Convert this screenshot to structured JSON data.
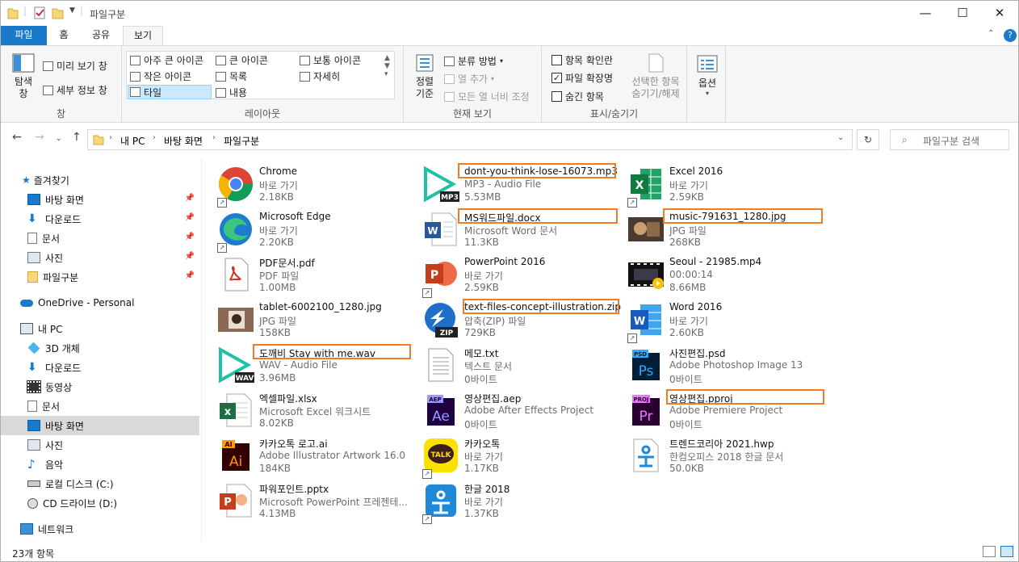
{
  "window": {
    "title": "파일구분",
    "min": "—",
    "max": "☐",
    "close": "✕"
  },
  "tabs": {
    "file": "파일",
    "home": "홈",
    "share": "공유",
    "view": "보기"
  },
  "ribbon": {
    "pane": {
      "nav_pane": "탐색\n창",
      "preview": "미리 보기 창",
      "details": "세부 정보 창",
      "label": "창"
    },
    "layout": {
      "xl": "아주 큰 아이콘",
      "large": "큰 아이콘",
      "medium": "보통 아이콘",
      "small": "작은 아이콘",
      "list": "목록",
      "details": "자세히",
      "tiles": "타일",
      "content": "내용",
      "label": "레이아웃"
    },
    "current": {
      "sort": "정렬\n기준",
      "group": "분류 방법",
      "addcol": "열 추가",
      "fit": "모든 열 너비 조정",
      "label": "현재 보기"
    },
    "show": {
      "checkboxes": "항목 확인란",
      "extensions": "파일 확장명",
      "hidden": "숨긴 항목",
      "hide_sel": "선택한 항목\n숨기기/해제",
      "label": "표시/숨기기"
    },
    "options": {
      "label": "옵션"
    }
  },
  "address": {
    "crumbs": [
      "내 PC",
      "바탕 화면",
      "파일구분"
    ],
    "search_placeholder": "파일구분 검색"
  },
  "nav": {
    "quick": "즐겨찾기",
    "quick_items": [
      "바탕 화면",
      "다운로드",
      "문서",
      "사진",
      "파일구분"
    ],
    "onedrive": "OneDrive - Personal",
    "pc": "내 PC",
    "pc_items": [
      "3D 개체",
      "다운로드",
      "동영상",
      "문서",
      "바탕 화면",
      "사진",
      "음악",
      "로컬 디스크 (C:)",
      "CD 드라이브 (D:)"
    ],
    "network": "네트워크"
  },
  "files": [
    {
      "name": "Chrome",
      "type": "바로 가기",
      "size": "2.18KB",
      "icon": "chrome-icon"
    },
    {
      "name": "Microsoft Edge",
      "type": "바로 가기",
      "size": "2.20KB",
      "icon": "edge-icon"
    },
    {
      "name": "PDF문서.pdf",
      "type": "PDF 파일",
      "size": "1.00MB",
      "icon": "pdf-icon"
    },
    {
      "name": "tablet-6002100_1280.jpg",
      "type": "JPG 파일",
      "size": "158KB",
      "icon": "photo-icon"
    },
    {
      "name": "도깨비   Stay with me.wav",
      "type": "WAV - Audio File",
      "size": "3.96MB",
      "icon": "wav-icon"
    },
    {
      "name": "엑셀파일.xlsx",
      "type": "Microsoft Excel 워크시트",
      "size": "8.02KB",
      "icon": "excel-doc-icon"
    },
    {
      "name": "카카오톡 로고.ai",
      "type": "Adobe Illustrator Artwork 16.0",
      "size": "184KB",
      "icon": "ai-icon"
    },
    {
      "name": "파워포인트.pptx",
      "type": "Microsoft PowerPoint 프레젠테...",
      "size": "4.13MB",
      "icon": "ppt-doc-icon"
    },
    {
      "name": "dont-you-think-lose-16073.mp3",
      "type": "MP3 - Audio File",
      "size": "5.53MB",
      "icon": "mp3-icon"
    },
    {
      "name": "MS워드파일.docx",
      "type": "Microsoft Word 문서",
      "size": "11.3KB",
      "icon": "word-doc-icon"
    },
    {
      "name": "PowerPoint 2016",
      "type": "바로 가기",
      "size": "2.59KB",
      "icon": "powerpoint-icon"
    },
    {
      "name": "text-files-concept-illustration.zip",
      "type": "압축(ZIP) 파일",
      "size": "729KB",
      "icon": "zip-icon"
    },
    {
      "name": "메모.txt",
      "type": "텍스트 문서",
      "size": "0바이트",
      "icon": "text-file-icon"
    },
    {
      "name": "영상편집.aep",
      "type": "Adobe After Effects Project",
      "size": "0바이트",
      "icon": "ae-icon"
    },
    {
      "name": "카카오톡",
      "type": "바로 가기",
      "size": "1.17KB",
      "icon": "kakaotalk-icon"
    },
    {
      "name": "한글 2018",
      "type": "바로 가기",
      "size": "1.37KB",
      "icon": "hangul-icon"
    },
    {
      "name": "Excel 2016",
      "type": "바로 가기",
      "size": "2.59KB",
      "icon": "excel-icon"
    },
    {
      "name": "music-791631_1280.jpg",
      "type": "JPG 파일",
      "size": "268KB",
      "icon": "photo-icon"
    },
    {
      "name": "Seoul - 21985.mp4",
      "type": "00:00:14",
      "size": "8.66MB",
      "icon": "video-icon"
    },
    {
      "name": "Word 2016",
      "type": "바로 가기",
      "size": "2.60KB",
      "icon": "word-icon"
    },
    {
      "name": "사진편집.psd",
      "type": "Adobe Photoshop Image 13",
      "size": "0바이트",
      "icon": "ps-icon"
    },
    {
      "name": "영상편집.pproj",
      "type": "Adobe Premiere Project",
      "size": "0바이트",
      "icon": "pr-icon"
    },
    {
      "name": "트렌드코리아 2021.hwp",
      "type": "한컴오피스 2018 한글 문서",
      "size": "50.0KB",
      "icon": "hwp-icon"
    }
  ],
  "status": {
    "count": "23개 항목"
  },
  "colors": {
    "accent": "#1979ca",
    "highlight": "#f07c26"
  }
}
